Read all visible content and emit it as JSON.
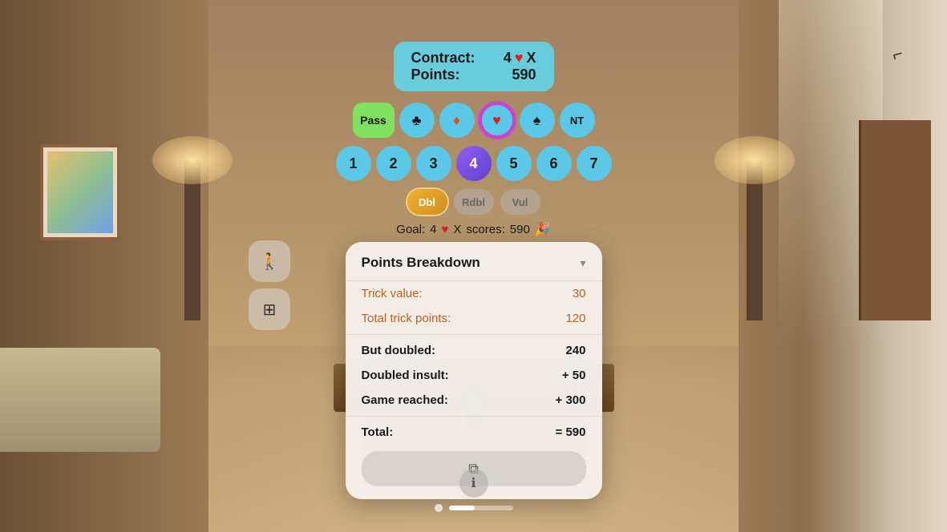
{
  "background": {
    "description": "Living room interior"
  },
  "contract_panel": {
    "contract_label": "Contract:",
    "contract_value": "4",
    "contract_suit": "♥",
    "contract_double": "X",
    "points_label": "Points:",
    "points_value": "590"
  },
  "bid_suits": [
    {
      "id": "pass",
      "label": "Pass",
      "type": "pass"
    },
    {
      "id": "club",
      "label": "♣",
      "type": "club"
    },
    {
      "id": "diamond",
      "label": "♦",
      "type": "diamond"
    },
    {
      "id": "heart",
      "label": "♥",
      "type": "heart",
      "selected": true
    },
    {
      "id": "spade",
      "label": "♠",
      "type": "spade"
    },
    {
      "id": "nt",
      "label": "NT",
      "type": "nt"
    }
  ],
  "bid_numbers": [
    {
      "label": "1",
      "selected": false
    },
    {
      "label": "2",
      "selected": false
    },
    {
      "label": "3",
      "selected": false
    },
    {
      "label": "4",
      "selected": true
    },
    {
      "label": "5",
      "selected": false
    },
    {
      "label": "6",
      "selected": false
    },
    {
      "label": "7",
      "selected": false
    }
  ],
  "modifiers": [
    {
      "id": "dbl",
      "label": "Dbl",
      "active": true
    },
    {
      "id": "rdbl",
      "label": "Rdbl",
      "active": false
    },
    {
      "id": "vul",
      "label": "Vul",
      "active": false
    }
  ],
  "goal_row": {
    "prefix": "Goal:",
    "number": "4",
    "suit": "♥",
    "multiplier": "X",
    "suffix": "scores:",
    "score": "590",
    "icon": "🎉"
  },
  "breakdown": {
    "title": "Points Breakdown",
    "chevron": "▾",
    "rows": [
      {
        "label": "Trick value:",
        "value": "30",
        "bold": false
      },
      {
        "label": "Total trick points:",
        "value": "120",
        "bold": false
      },
      {
        "label": "But doubled:",
        "value": "240",
        "bold": true
      },
      {
        "label": "Doubled insult:",
        "value": "+ 50",
        "bold": true
      },
      {
        "label": "Game reached:",
        "value": "+ 300",
        "bold": true
      },
      {
        "label": "Total:",
        "value": "= 590",
        "bold": true
      }
    ],
    "copy_button_icon": "⧉"
  },
  "sidebar": {
    "buttons": [
      {
        "id": "walk",
        "icon": "🚶",
        "label": "walk-icon"
      },
      {
        "id": "grid",
        "icon": "⊞",
        "label": "grid-icon"
      }
    ]
  },
  "bottom_bar": {
    "info_icon": "ℹ",
    "progress_dot": "●",
    "progress_label": "progress"
  },
  "top_right": {
    "icon": "⌐"
  }
}
